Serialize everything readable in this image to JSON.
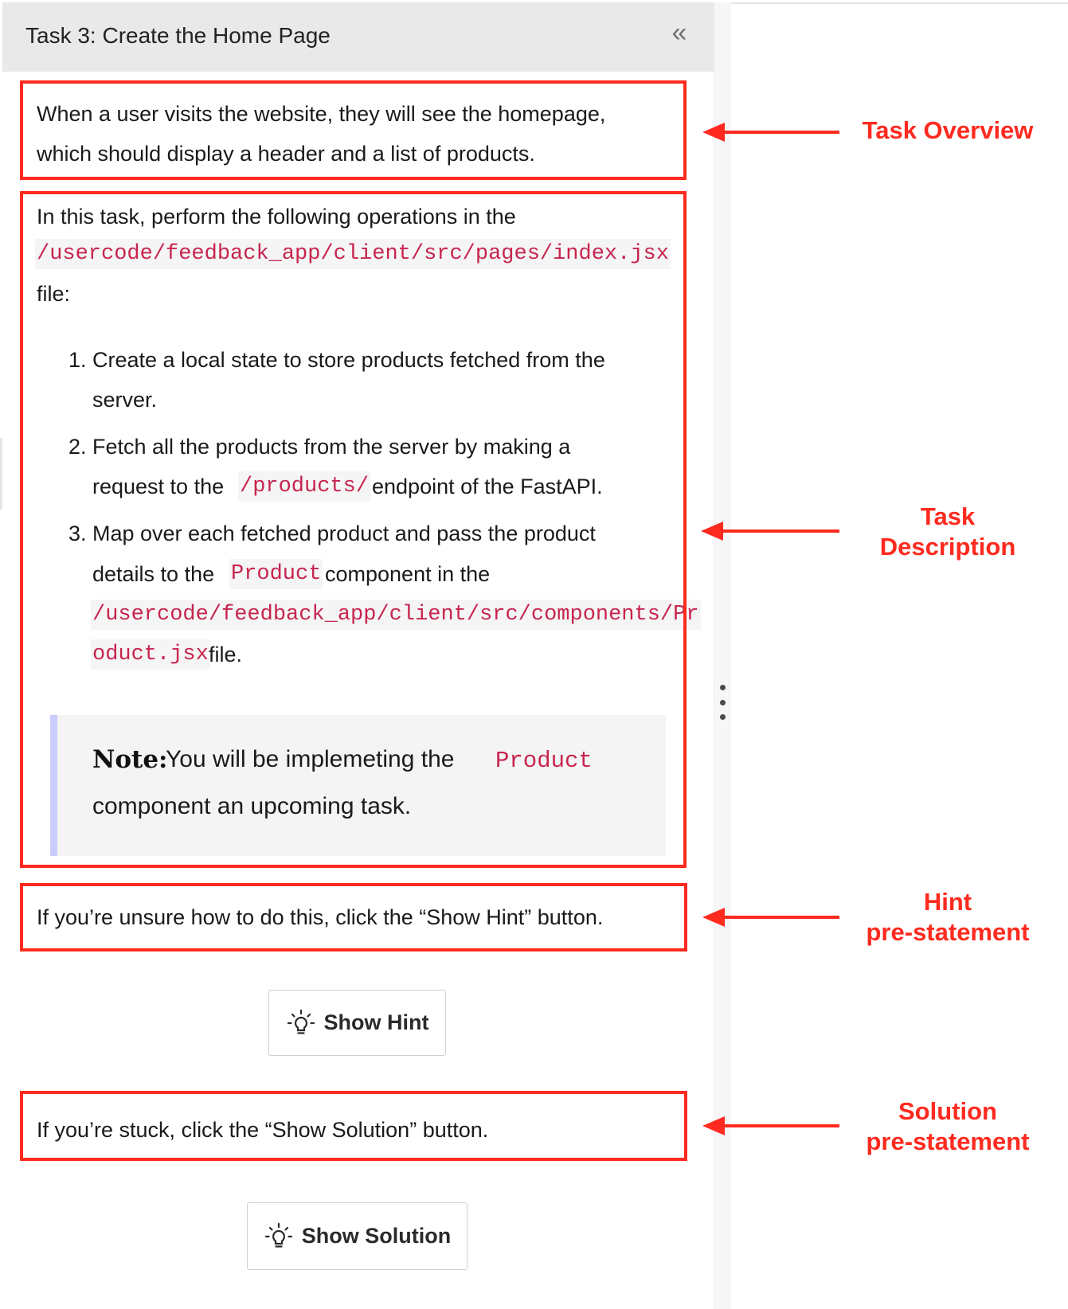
{
  "header": {
    "title": "Task 3: Create the Home Page",
    "collapse_icon": "«"
  },
  "overview": {
    "line1": "When a user visits the website, they will see the homepage,",
    "line2": "which should display a header and a list of products."
  },
  "description": {
    "intro": "In this task, perform the following operations in the",
    "path": "/usercode/feedback_app/client/src/pages/index.jsx",
    "file_word": "file:",
    "steps": [
      {
        "number": "1.",
        "line1": "Create a local state to store products fetched from the",
        "line2": "server."
      },
      {
        "number": "2.",
        "line1": "Fetch all the products from the server by making a",
        "line2_pre": "request to the",
        "code": "/products/",
        "line2_post": "endpoint of the FastAPI."
      },
      {
        "number": "3.",
        "line1": "Map over each fetched product and pass the product",
        "line2_pre": "details to the",
        "code": "Product",
        "line2_post": "component in the",
        "path_part1": "/usercode/feedback_app/client/src/components/Pr",
        "path_part2": "oduct.jsx",
        "line4_post": "file."
      }
    ],
    "note": {
      "label": "Note:",
      "text_pre": "You will be implemeting the",
      "code": "Product",
      "text_line2": "component an upcoming task."
    }
  },
  "hint": {
    "pre_statement": "If you’re unsure how to do this, click the “Show Hint” button.",
    "button_label": "Show Hint"
  },
  "solution": {
    "pre_statement": "If you’re stuck, click the “Show Solution” button.",
    "button_label": "Show Solution"
  },
  "annotations": {
    "task_overview": "Task Overview",
    "task_description_1": "Task",
    "task_description_2": "Description",
    "hint_1": "Hint",
    "hint_2": "pre-statement",
    "solution_1": "Solution",
    "solution_2": "pre-statement"
  },
  "colors": {
    "annotation_red": "#ff2a1f",
    "code_text": "#c7254e",
    "note_bar": "#c9cdfc"
  }
}
